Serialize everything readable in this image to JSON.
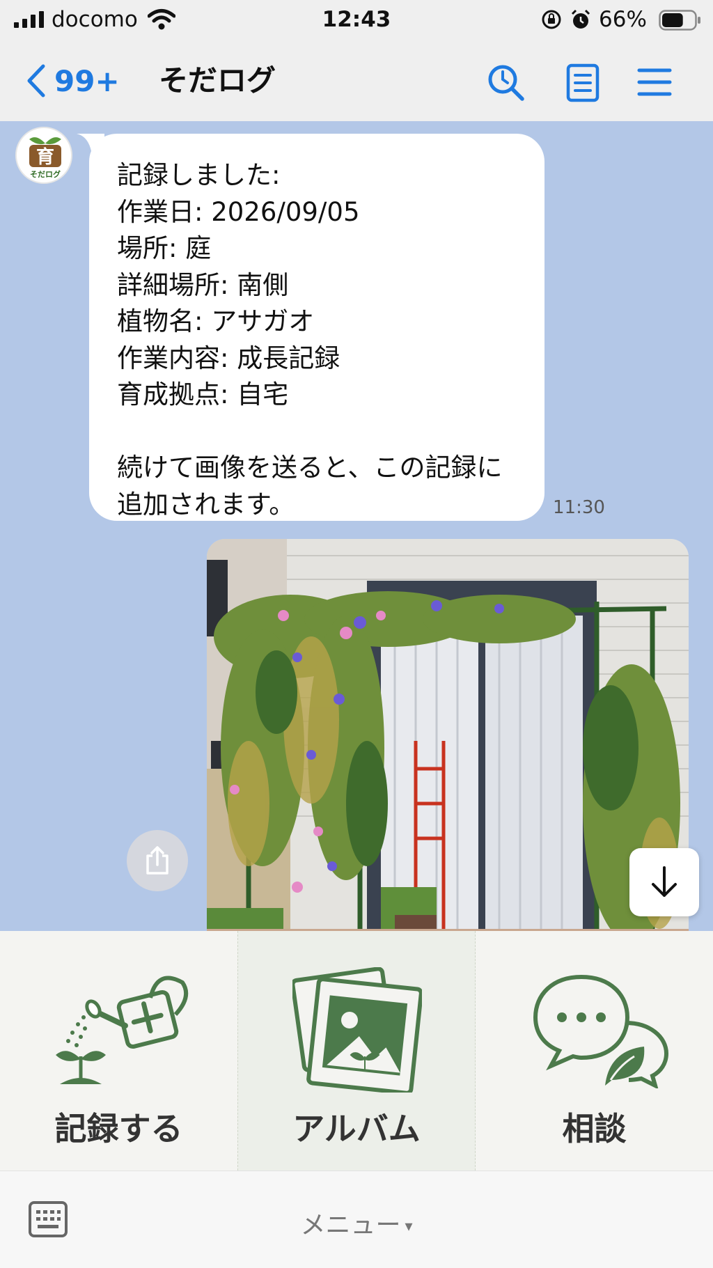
{
  "status_bar": {
    "carrier": "docomo",
    "time": "12:43",
    "battery_percent": "66%",
    "battery_level": 0.66
  },
  "nav": {
    "back_count": "99+",
    "title": "そだログ"
  },
  "chat": {
    "bot_avatar": {
      "glyph": "育",
      "brand": "そだログ"
    },
    "message": {
      "text": "記録しました:\n作業日: 2026/09/05\n場所: 庭\n詳細場所: 南側\n植物名: アサガオ\n作業内容: 成長記録\n育成拠点: 自宅\n\n続けて画像を送ると、この記録に追加されます。",
      "time": "11:30"
    }
  },
  "rich_menu": {
    "items": [
      {
        "label": "記録する",
        "icon": "watering-can-icon"
      },
      {
        "label": "アルバム",
        "icon": "photo-album-icon"
      },
      {
        "label": "相談",
        "icon": "chat-bubbles-icon"
      }
    ]
  },
  "bottom_bar": {
    "menu_label": "メニュー",
    "caret": "▾"
  },
  "colors": {
    "accent_blue": "#1f7ae0",
    "chat_background": "#b3c7e7",
    "menu_green": "#4c7a4b"
  }
}
